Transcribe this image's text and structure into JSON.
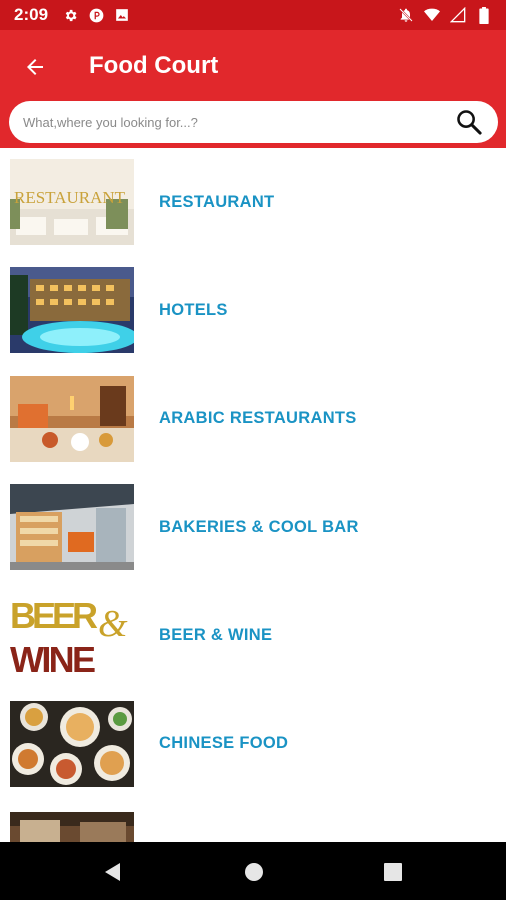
{
  "status_bar": {
    "time": "2:09",
    "icons": [
      "settings-icon",
      "parking-icon",
      "image-icon",
      "notifications-off-icon",
      "wifi-icon",
      "signal-icon",
      "battery-icon"
    ]
  },
  "app_bar": {
    "title": "Food Court",
    "back_icon": "arrow-back-icon",
    "background": "#e1282c"
  },
  "search": {
    "placeholder": "What,where you looking for...?",
    "icon": "search-icon"
  },
  "categories": [
    {
      "label": "RESTAURANT",
      "thumb_text": "RESTAURANT"
    },
    {
      "label": "HOTELS"
    },
    {
      "label": "ARABIC RESTAURANTS"
    },
    {
      "label": "BAKERIES & COOL BAR"
    },
    {
      "label": "BEER & WINE",
      "thumb_text_1": "BEER",
      "thumb_text_2": "&",
      "thumb_text_3": "WINE"
    },
    {
      "label": "CHINESE FOOD"
    }
  ],
  "colors": {
    "accent": "#e1282c",
    "status": "#c8161b",
    "label": "#1a93c4"
  },
  "nav_bar": {
    "icons": [
      "back-triangle-icon",
      "home-circle-icon",
      "recents-square-icon"
    ]
  }
}
